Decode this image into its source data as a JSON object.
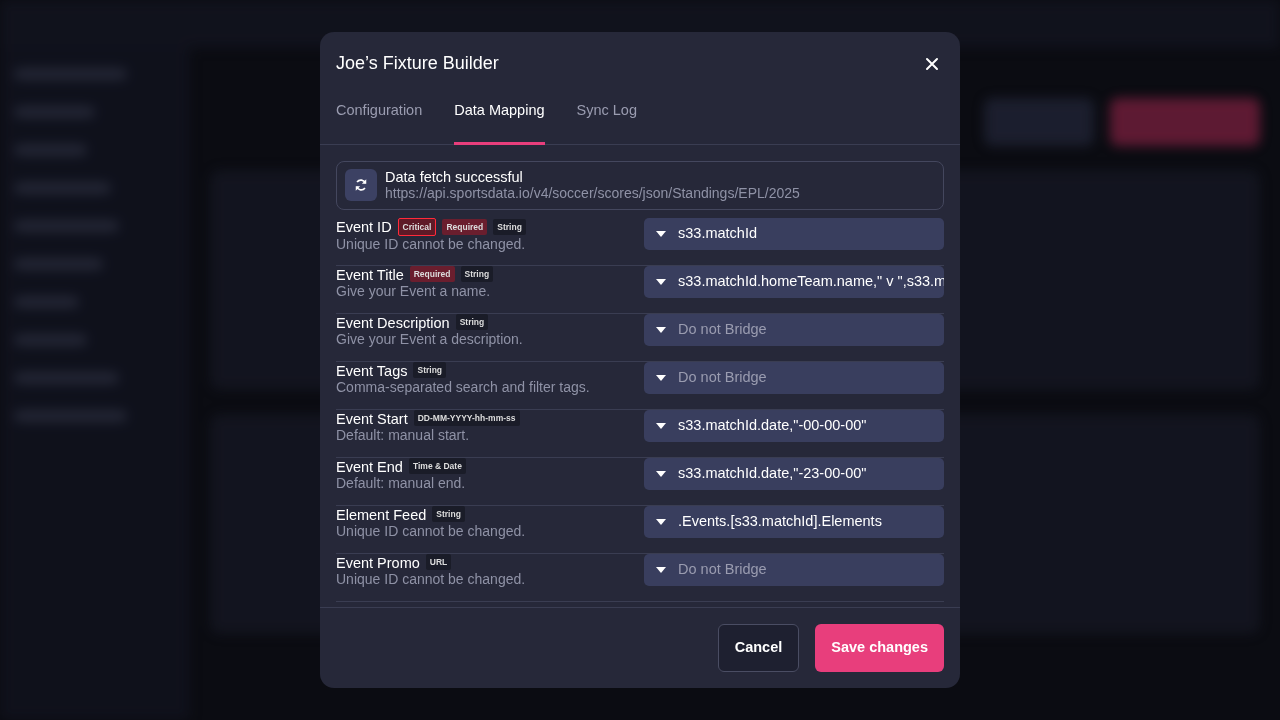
{
  "dialog": {
    "title": "Joe’s Fixture Builder",
    "tabs": [
      {
        "label": "Configuration",
        "selected": false
      },
      {
        "label": "Data Mapping",
        "selected": true
      },
      {
        "label": "Sync Log",
        "selected": false
      }
    ],
    "status": {
      "title": "Data fetch successful",
      "url": "https://api.sportsdata.io/v4/soccer/scores/json/Standings/EPL/2025"
    },
    "fields": [
      {
        "label": "Event ID",
        "badges": [
          {
            "text": "Critical",
            "kind": "critical"
          },
          {
            "text": "Required",
            "kind": "required"
          },
          {
            "text": "String",
            "kind": "type"
          }
        ],
        "hint": "Unique ID cannot be changed.",
        "value": "s33.matchId"
      },
      {
        "label": "Event Title",
        "badges": [
          {
            "text": "Required",
            "kind": "required"
          },
          {
            "text": "String",
            "kind": "type"
          }
        ],
        "hint": "Give your Event a name.",
        "value": "s33.matchId.homeTeam.name,\" v \",s33.m"
      },
      {
        "label": "Event Description",
        "badges": [
          {
            "text": "String",
            "kind": "type"
          }
        ],
        "hint": "Give your Event a description.",
        "placeholder": "Do not Bridge"
      },
      {
        "label": "Event Tags",
        "badges": [
          {
            "text": "String",
            "kind": "type"
          }
        ],
        "hint": "Comma-separated search and filter tags.",
        "placeholder": "Do not Bridge"
      },
      {
        "label": "Event Start",
        "badges": [
          {
            "text": "DD-MM-YYYY-hh-mm-ss",
            "kind": "type"
          }
        ],
        "hint": "Default: manual start.",
        "value": "s33.matchId.date,\"-00-00-00\""
      },
      {
        "label": "Event End",
        "badges": [
          {
            "text": "Time & Date",
            "kind": "type"
          }
        ],
        "hint": "Default: manual end.",
        "value": "s33.matchId.date,\"-23-00-00\""
      },
      {
        "label": "Element Feed",
        "badges": [
          {
            "text": "String",
            "kind": "type"
          }
        ],
        "hint": "Unique ID cannot be changed.",
        "value": ".Events.[s33.matchId].Elements"
      },
      {
        "label": "Event Promo",
        "badges": [
          {
            "text": "URL",
            "kind": "type"
          }
        ],
        "hint": "Unique ID cannot be changed.",
        "placeholder": "Do not Bridge"
      }
    ],
    "buttons": [
      {
        "label": "Cancel",
        "kind": "secondary"
      },
      {
        "label": "Save changes",
        "kind": "primary"
      }
    ]
  }
}
